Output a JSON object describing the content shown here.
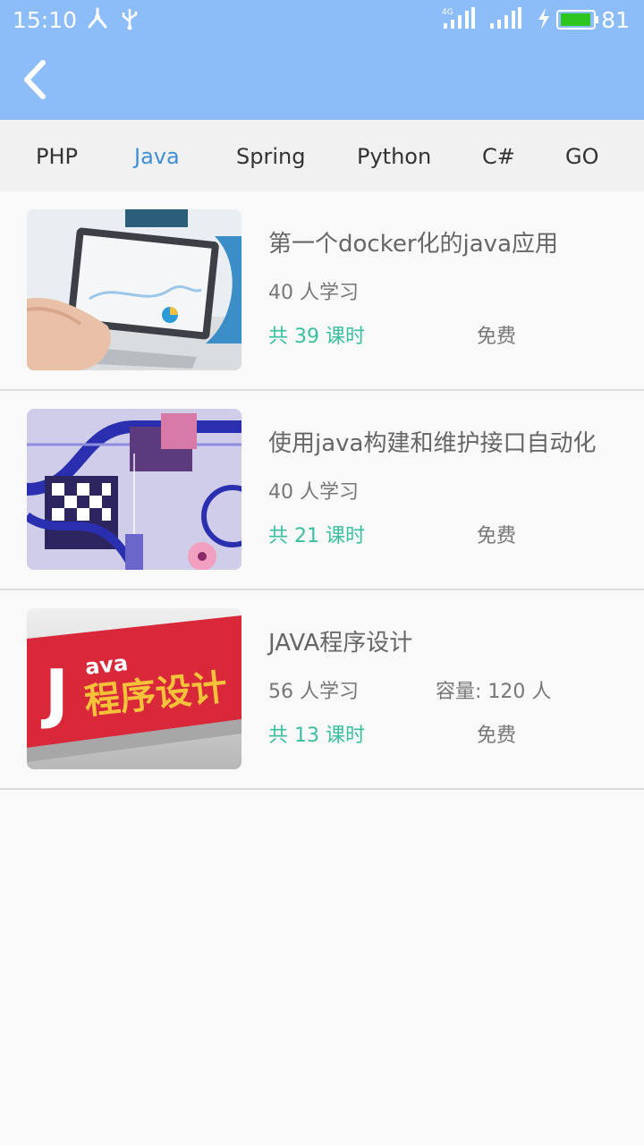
{
  "status_bar": {
    "time": "15:10",
    "battery": "81",
    "network_label": "4G",
    "icons": [
      "share-icon",
      "usb-icon",
      "signal-icon",
      "signal-icon",
      "charging-icon",
      "battery-icon"
    ]
  },
  "header": {
    "back_icon": "chevron-left-icon",
    "background_color": "#8cbdf8"
  },
  "tabs": [
    {
      "label": "PHP",
      "active": false
    },
    {
      "label": "Java",
      "active": true
    },
    {
      "label": "Spring",
      "active": false
    },
    {
      "label": "Python",
      "active": false
    },
    {
      "label": "C#",
      "active": false
    },
    {
      "label": "GO",
      "active": false
    }
  ],
  "colors": {
    "active_tab": "#3f8fd6",
    "lessons_text": "#3bbf9f",
    "header": "#8cbdf8"
  },
  "courses": [
    {
      "title": "第一个docker化的java应用",
      "students": "40 人学习",
      "capacity": "",
      "lessons": "共 39 课时",
      "price": "免费"
    },
    {
      "title": "使用java构建和维护接口自动化",
      "students": "40 人学习",
      "capacity": "",
      "lessons": "共 21 课时",
      "price": "免费"
    },
    {
      "title": "JAVA程序设计",
      "students": "56 人学习",
      "capacity": "容量: 120 人",
      "lessons": "共 13 课时",
      "price": "免费",
      "thumb_text_small": "ava",
      "thumb_text_big": "程序设计",
      "thumb_letter": "J"
    }
  ]
}
